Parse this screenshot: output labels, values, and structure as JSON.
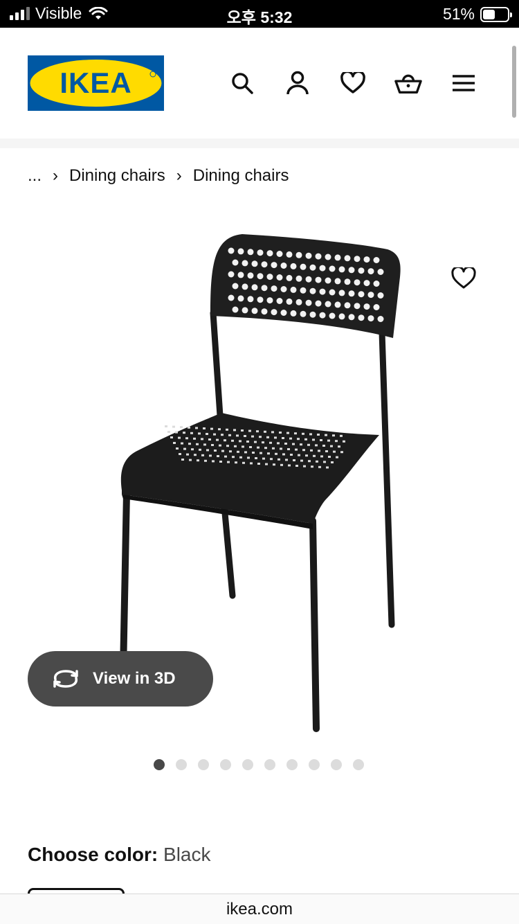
{
  "status_bar": {
    "carrier": "Visible",
    "time": "오후 5:32",
    "battery_percent": "51%",
    "battery_level": 0.51,
    "signal_bars": 3,
    "icons": [
      "signal-icon",
      "wifi-icon",
      "battery-icon"
    ]
  },
  "header": {
    "logo_text": "IKEA",
    "icons": [
      "search-icon",
      "user-icon",
      "heart-icon",
      "cart-icon",
      "menu-icon"
    ],
    "colors": {
      "logo_blue": "#0058a3",
      "logo_yellow": "#ffdb00"
    }
  },
  "breadcrumb": {
    "ellipsis": "...",
    "items": [
      "Dining chairs",
      "Dining chairs"
    ],
    "separator": "›"
  },
  "product": {
    "image_description_icon": "chair-image",
    "view_3d_label": "View in 3D",
    "gallery_total": 10,
    "gallery_active_index": 0
  },
  "color_choice": {
    "label": "Choose color:",
    "value": "Black"
  },
  "browser": {
    "url": "ikea.com"
  }
}
